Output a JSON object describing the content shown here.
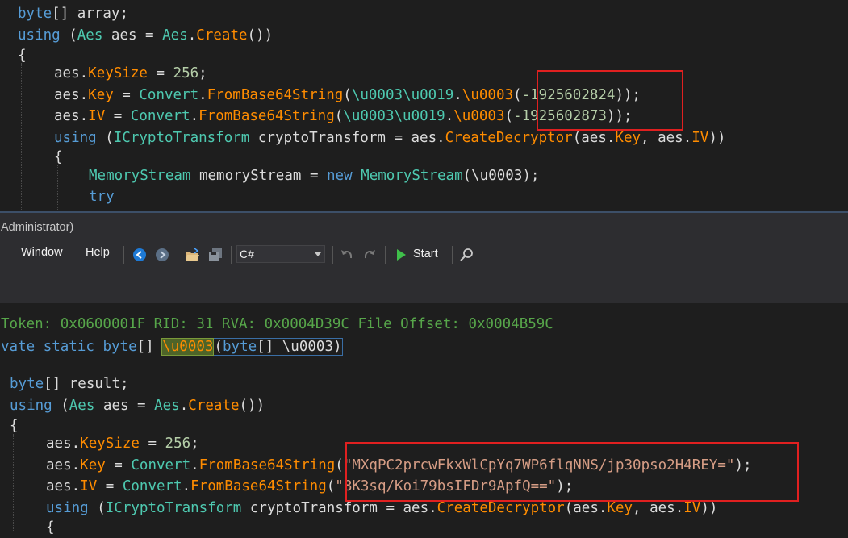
{
  "window": {
    "title": "Administrator)",
    "menu": [
      "Window",
      "Help"
    ],
    "language": "C#",
    "start_label": "Start"
  },
  "top_code": {
    "l1": {
      "kw1": "byte",
      "rest": "[] array;"
    },
    "l2": {
      "kw": "using",
      "p1": " (",
      "ty1": "Aes",
      "p2": " aes = ",
      "ty2": "Aes",
      "p3": ".",
      "mem": "Create",
      "p4": "())"
    },
    "l3": "{",
    "l4": {
      "p1": "aes.",
      "mem": "KeySize",
      "p2": " = ",
      "num": "256",
      "p3": ";"
    },
    "l5": {
      "p1": "aes.",
      "mem1": "Key",
      "p2": " = ",
      "ty": "Convert",
      "p3": ".",
      "mem2": "FromBase64String",
      "p4": "(",
      "esc1": "\\u0003\\u0019",
      "p5": ".",
      "esc2": "\\u0003",
      "p6": "(",
      "num": "-1925602824",
      "p7": "));"
    },
    "l6": {
      "p1": "aes.",
      "mem1": "IV",
      "p2": " = ",
      "ty": "Convert",
      "p3": ".",
      "mem2": "FromBase64String",
      "p4": "(",
      "esc1": "\\u0003\\u0019",
      "p5": ".",
      "esc2": "\\u0003",
      "p6": "(",
      "num": "-1925602873",
      "p7": "));"
    },
    "l7": {
      "kw": "using",
      "p1": " (",
      "ty": "ICryptoTransform",
      "p2": " cryptoTransform = aes.",
      "mem1": "CreateDecryptor",
      "p3": "(aes.",
      "mem2": "Key",
      "p4": ", aes.",
      "mem3": "IV",
      "p5": "))"
    },
    "l8": "{",
    "l9": {
      "ty1": "MemoryStream",
      "p1": " memoryStream = ",
      "kw": "new",
      "p2": " ",
      "ty2": "MemoryStream",
      "p3": "(\\u0003);"
    },
    "l10": {
      "kw": "try"
    }
  },
  "bottom_code": {
    "token_line": "Token: 0x0600001F RID: 31 RVA: 0x0004D39C File Offset: 0x0004B59C",
    "sig": {
      "kw1": "vate",
      "kw2": "static",
      "kw3": "byte",
      "p1": "[] ",
      "name": "\\u0003",
      "p2": "(",
      "kw4": "byte",
      "p3": "[] \\u0003)"
    },
    "l1": {
      "kw": "byte",
      "rest": "[] result;"
    },
    "l2": {
      "kw": "using",
      "p1": " (",
      "ty1": "Aes",
      "p2": " aes = ",
      "ty2": "Aes",
      "p3": ".",
      "mem": "Create",
      "p4": "())"
    },
    "l3": "{",
    "l4": {
      "p1": "aes.",
      "mem": "KeySize",
      "p2": " = ",
      "num": "256",
      "p3": ";"
    },
    "l5": {
      "p1": "aes.",
      "mem1": "Key",
      "p2": " = ",
      "ty": "Convert",
      "p3": ".",
      "mem2": "FromBase64String",
      "p4": "(",
      "str": "\"MXqPC2prcwFkxWlCpYq7WP6flqNNS/jp30pso2H4REY=\"",
      "p5": ");"
    },
    "l6": {
      "p1": "aes.",
      "mem1": "IV",
      "p2": " = ",
      "ty": "Convert",
      "p3": ".",
      "mem2": "FromBase64String",
      "p4": "(",
      "str": "\"8K3sq/Koi79bsIFDr9ApfQ==\"",
      "p5": ");"
    },
    "l7": {
      "kw": "using",
      "p1": " (",
      "ty": "ICryptoTransform",
      "p2": " cryptoTransform = aes.",
      "mem1": "CreateDecryptor",
      "p3": "(aes.",
      "mem2": "Key",
      "p4": ", aes.",
      "mem3": "IV",
      "p5": "))"
    },
    "l8": "{"
  },
  "colors": {
    "keyword": "#569cd6",
    "type": "#4ec9b0",
    "member": "#ff8c00",
    "number": "#b5cea8",
    "string": "#d69d85",
    "annotation_box": "#e02020"
  },
  "icons": [
    "back-icon",
    "forward-icon",
    "open-folder-icon",
    "save-all-icon",
    "undo-icon",
    "redo-icon",
    "play-icon",
    "search-icon"
  ]
}
